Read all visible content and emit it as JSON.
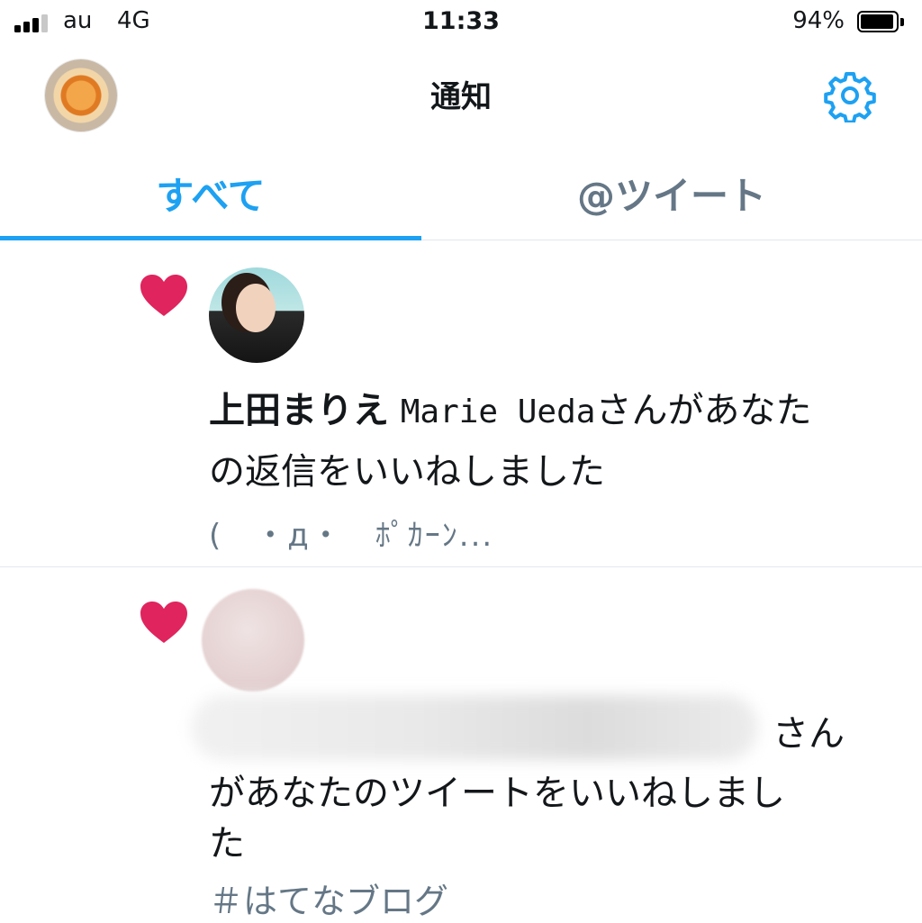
{
  "status_bar": {
    "carrier": "au",
    "network": "4G",
    "time": "11:33",
    "battery_percent": "94%",
    "battery_level": 0.94,
    "signal_bars_filled": 3,
    "signal_bars_total": 4
  },
  "header": {
    "title": "通知",
    "profile_icon": "avatar",
    "settings_icon": "gear-icon",
    "accent": "#1da1f2"
  },
  "tabs": [
    {
      "label": "すべて",
      "selected": true
    },
    {
      "label": "@ツイート",
      "selected": false
    }
  ],
  "notifications": [
    {
      "icon": "heart-icon",
      "name": "上田まりえ",
      "handle": "Marie Ueda",
      "line1_suffix": "さんがあなた",
      "line2": "の返信をいいねしました",
      "preview": "(　・д・　ﾎﾟｶｰﾝ..."
    },
    {
      "icon": "heart-icon",
      "name_redacted": true,
      "line1_suffix": "さん",
      "line2": "があなたのツイートをいいねしまし",
      "line3": "た",
      "preview": "＃はてなブログ"
    }
  ],
  "colors": {
    "heart": "#e0245e",
    "secondary_text": "#657786",
    "divider": "#e1e8ed"
  }
}
